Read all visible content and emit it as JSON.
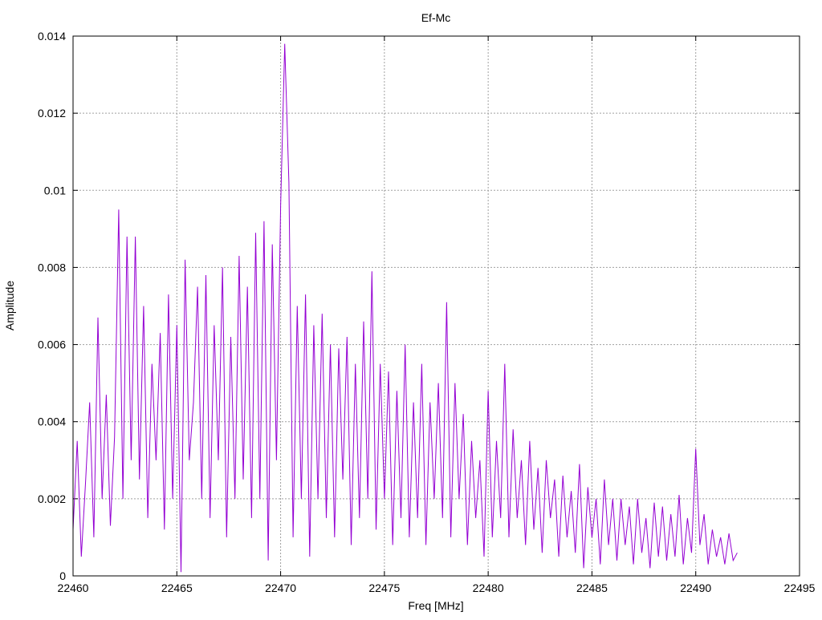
{
  "chart_data": {
    "type": "line",
    "title": "Ef-Mc",
    "xlabel": "Freq [MHz]",
    "ylabel": "Amplitude",
    "xlim": [
      22460,
      22495
    ],
    "ylim": [
      0,
      0.014
    ],
    "xticks": [
      22460,
      22465,
      22470,
      22475,
      22480,
      22485,
      22490,
      22495
    ],
    "xtick_labels": [
      "22460",
      "22465",
      "22470",
      "22475",
      "22480",
      "22485",
      "22490",
      "22495"
    ],
    "yticks": [
      0,
      0.002,
      0.004,
      0.006,
      0.008,
      0.01,
      0.012,
      0.014
    ],
    "ytick_labels": [
      "0",
      "0.002",
      "0.004",
      "0.006",
      "0.008",
      "0.01",
      "0.012",
      "0.014"
    ],
    "grid": true,
    "legend": "none",
    "series": [
      {
        "name": "Ef-Mc",
        "color": "#9400d3",
        "x_start": 22460,
        "x_step": 0.2,
        "values": [
          0.0012,
          0.0035,
          0.0005,
          0.0024,
          0.0045,
          0.001,
          0.0067,
          0.002,
          0.0047,
          0.0013,
          0.0036,
          0.0095,
          0.002,
          0.0088,
          0.003,
          0.0088,
          0.0025,
          0.007,
          0.0015,
          0.0055,
          0.003,
          0.0063,
          0.0012,
          0.0073,
          0.002,
          0.0065,
          0.0001,
          0.0082,
          0.003,
          0.0045,
          0.0075,
          0.002,
          0.0078,
          0.0015,
          0.0065,
          0.003,
          0.008,
          0.001,
          0.0062,
          0.002,
          0.0083,
          0.0025,
          0.0075,
          0.0015,
          0.0089,
          0.002,
          0.0092,
          0.0004,
          0.0086,
          0.003,
          0.0096,
          0.0138,
          0.0102,
          0.001,
          0.007,
          0.002,
          0.0073,
          0.0005,
          0.0065,
          0.002,
          0.0068,
          0.0015,
          0.006,
          0.001,
          0.0059,
          0.0025,
          0.0062,
          0.0008,
          0.0055,
          0.0015,
          0.0066,
          0.002,
          0.0079,
          0.0012,
          0.0055,
          0.002,
          0.0053,
          0.0008,
          0.0048,
          0.0015,
          0.006,
          0.001,
          0.0045,
          0.0015,
          0.0055,
          0.0008,
          0.0045,
          0.002,
          0.005,
          0.0015,
          0.0071,
          0.001,
          0.005,
          0.002,
          0.0042,
          0.0008,
          0.0035,
          0.0015,
          0.003,
          0.0005,
          0.0048,
          0.001,
          0.0035,
          0.0015,
          0.0055,
          0.001,
          0.0038,
          0.0015,
          0.003,
          0.0008,
          0.0035,
          0.0012,
          0.0028,
          0.0006,
          0.003,
          0.0015,
          0.0025,
          0.0005,
          0.0026,
          0.001,
          0.0022,
          0.0006,
          0.0029,
          0.0002,
          0.0023,
          0.001,
          0.002,
          0.0003,
          0.0025,
          0.0008,
          0.002,
          0.0004,
          0.002,
          0.0008,
          0.0018,
          0.0003,
          0.002,
          0.0006,
          0.0015,
          0.0002,
          0.0019,
          0.0005,
          0.0018,
          0.0004,
          0.0016,
          0.0005,
          0.0021,
          0.0003,
          0.0015,
          0.0006,
          0.0033,
          0.0008,
          0.0016,
          0.0003,
          0.0012,
          0.0005,
          0.001,
          0.0003,
          0.0011,
          0.0004,
          0.0006
        ]
      }
    ]
  }
}
